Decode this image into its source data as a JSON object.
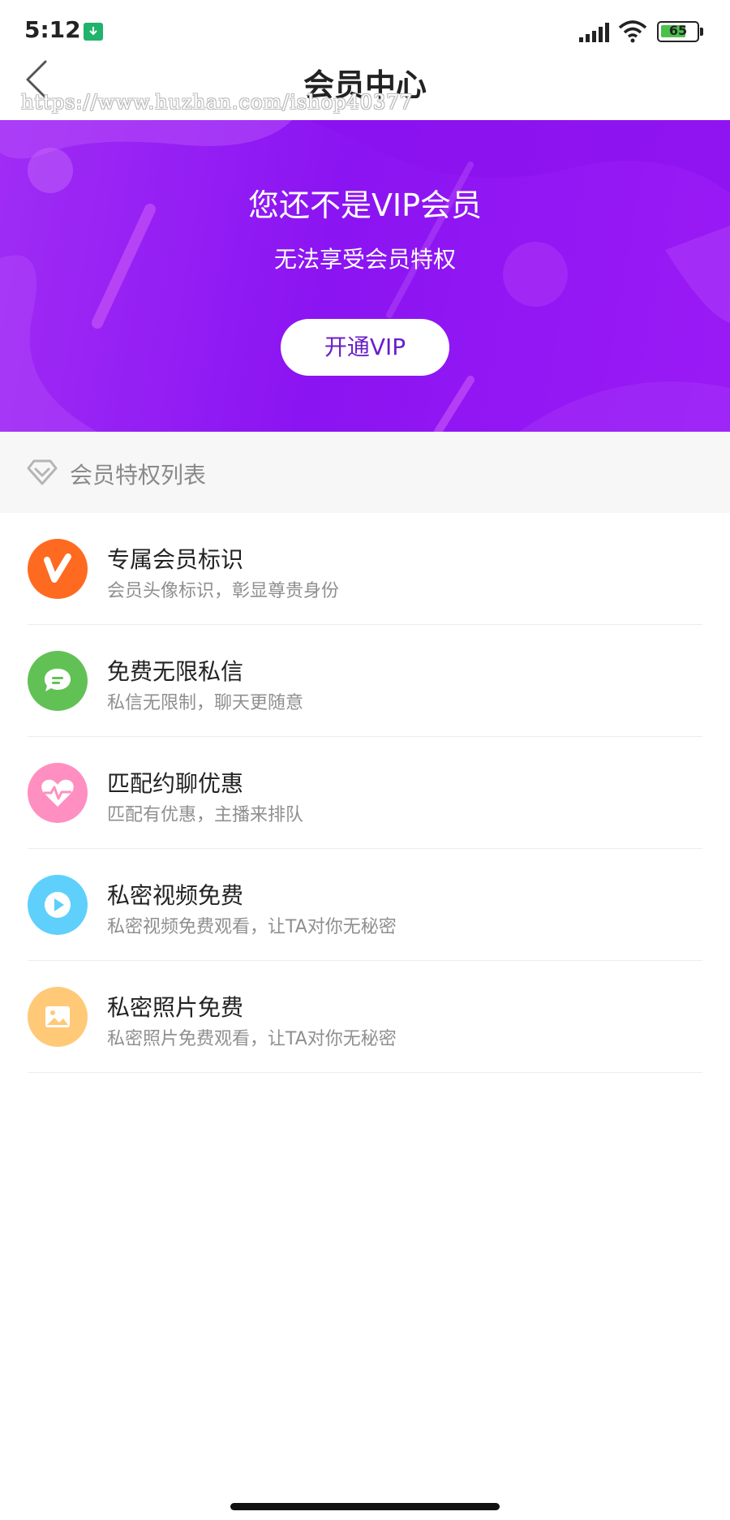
{
  "status_bar": {
    "time": "5:12",
    "battery_level": "65",
    "notification_icon": "download-icon",
    "signal_icon": "cellular-signal-icon",
    "wifi_icon": "wifi-icon"
  },
  "nav": {
    "title": "会员中心",
    "back_icon": "chevron-left-icon",
    "watermark": "https://www.huzhan.com/ishop40377"
  },
  "banner": {
    "title": "您还不是VIP会员",
    "subtitle": "无法享受会员特权",
    "button_label": "开通VIP"
  },
  "section": {
    "title": "会员特权列表",
    "icon": "diamond-icon"
  },
  "privileges": [
    {
      "title": "专属会员标识",
      "desc": "会员头像标识，彰显尊贵身份",
      "icon": "vip-badge-icon",
      "color": "#ff6a21"
    },
    {
      "title": "免费无限私信",
      "desc": "私信无限制，聊天更随意",
      "icon": "chat-bubble-icon",
      "color": "#62c155"
    },
    {
      "title": "匹配约聊优惠",
      "desc": "匹配有优惠，主播来排队",
      "icon": "heart-pulse-icon",
      "color": "#ff8fc0"
    },
    {
      "title": "私密视频免费",
      "desc": "私密视频免费观看，让TA对你无秘密",
      "icon": "play-icon",
      "color": "#5ed0fb"
    },
    {
      "title": "私密照片免费",
      "desc": "私密照片免费观看，让TA对你无秘密",
      "icon": "image-icon",
      "color": "#ffc978"
    }
  ],
  "colors": {
    "banner_start": "#a02cf5",
    "banner_end": "#8b14f2",
    "button_text": "#6a1fc8"
  }
}
